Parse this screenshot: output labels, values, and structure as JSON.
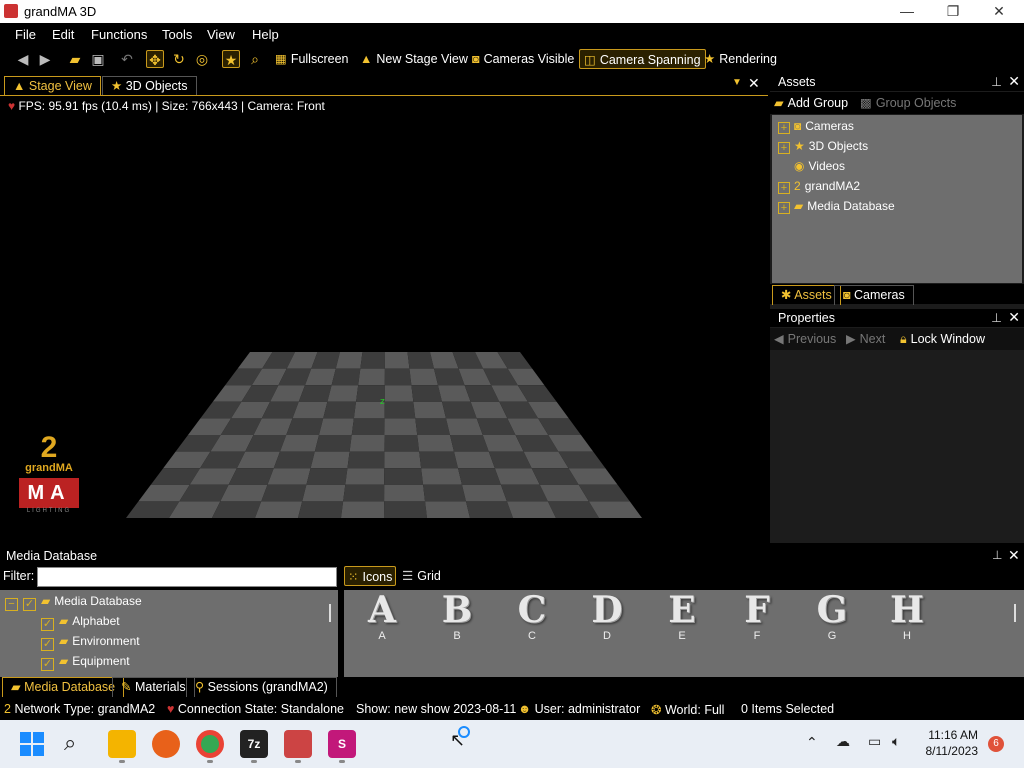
{
  "window": {
    "title": "grandMA 3D",
    "minimize": "—",
    "maximize": "❐",
    "close": "✕"
  },
  "menu": [
    "File",
    "Edit",
    "Functions",
    "Tools",
    "View",
    "Help"
  ],
  "toolbar": {
    "fullscreen": "Fullscreen",
    "new_stage_view": "New Stage View",
    "cameras_visible": "Cameras Visible",
    "camera_spanning": "Camera Spanning",
    "rendering": "Rendering"
  },
  "tabs": {
    "stage_view": "Stage View",
    "objects_3d": "3D Objects"
  },
  "stage": {
    "info": "FPS: 95.91 fps (10.4 ms) | Size: 766x443 | Camera: Front"
  },
  "logo": {
    "number": "2",
    "brand": "grandMA",
    "letters": "MA",
    "sub": "LIGHTING"
  },
  "assets": {
    "title": "Assets",
    "add_group": "Add Group",
    "group_objects": "Group Objects",
    "tree": [
      {
        "label": "Cameras",
        "expandable": true,
        "icon": "camera-icon"
      },
      {
        "label": "3D Objects",
        "expandable": true,
        "icon": "star-icon"
      },
      {
        "label": "Videos",
        "expandable": false,
        "icon": "video-icon"
      },
      {
        "label": "grandMA2",
        "expandable": true,
        "icon": "grandma2-icon"
      },
      {
        "label": "Media Database",
        "expandable": true,
        "icon": "media-database-icon"
      }
    ],
    "tab_assets": "Assets",
    "tab_cameras": "Cameras"
  },
  "properties": {
    "title": "Properties",
    "previous": "Previous",
    "next": "Next",
    "lock_window": "Lock Window"
  },
  "media_db": {
    "title": "Media Database",
    "filter_label": "Filter:",
    "filter_value": "",
    "view_icons": "Icons",
    "view_grid": "Grid",
    "tree": [
      {
        "label": "Media Database",
        "level": 0
      },
      {
        "label": "Alphabet",
        "level": 1
      },
      {
        "label": "Environment",
        "level": 1
      },
      {
        "label": "Equipment",
        "level": 1
      }
    ],
    "glyphs": [
      "A",
      "B",
      "C",
      "D",
      "E",
      "F",
      "G",
      "H"
    ]
  },
  "bottom_tabs": [
    "Media Database",
    "Materials",
    "Sessions (grandMA2)"
  ],
  "status": {
    "network": "Network Type: grandMA2",
    "connection": "Connection State: Standalone",
    "show": "Show: new show 2023-08-11",
    "user": "User: administrator",
    "world": "World: Full",
    "selected": "0 Items Selected"
  },
  "taskbar": {
    "time": "11:16 AM",
    "date": "8/11/2023",
    "notifications": "6"
  },
  "colors": {
    "accent": "#f2c230",
    "panel": "#6e6e6e",
    "background": "#000000"
  }
}
